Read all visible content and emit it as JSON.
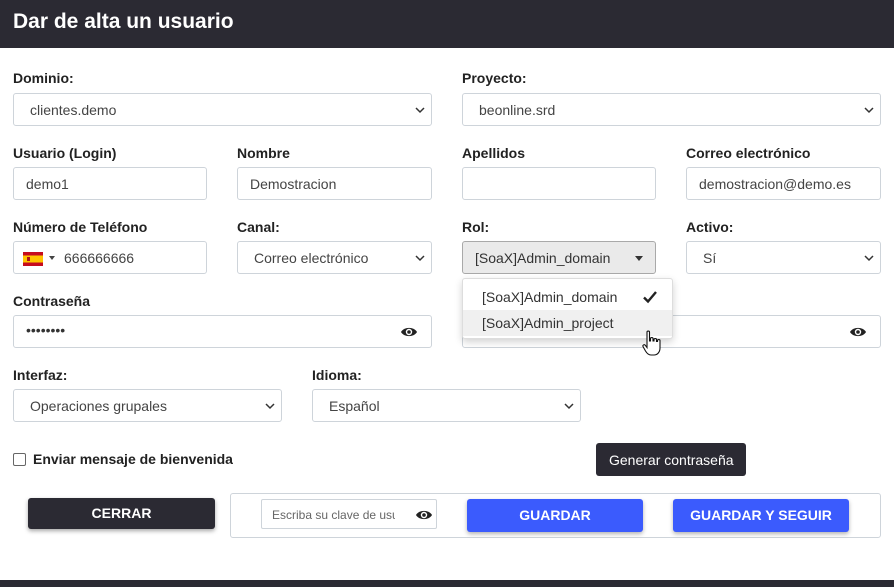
{
  "header": {
    "title": "Dar de alta un usuario"
  },
  "fields": {
    "dominio": {
      "label": "Dominio:",
      "value": "clientes.demo"
    },
    "proyecto": {
      "label": "Proyecto:",
      "value": "beonline.srd"
    },
    "usuario": {
      "label": "Usuario (Login)",
      "value": "demo1"
    },
    "nombre": {
      "label": "Nombre",
      "value": "Demostracion"
    },
    "apellidos": {
      "label": "Apellidos",
      "value": ""
    },
    "correo": {
      "label": "Correo electrónico",
      "value": "demostracion@demo.es"
    },
    "telefono": {
      "label": "Número de Teléfono",
      "value": "666666666",
      "flag": "spain-flag-icon"
    },
    "canal": {
      "label": "Canal:",
      "value": "Correo electrónico"
    },
    "rol": {
      "label": "Rol:",
      "value": "[SoaX]Admin_domain"
    },
    "activo": {
      "label": "Activo:",
      "value": "Sí"
    },
    "contrasena": {
      "label": "Contraseña",
      "value": "••••••••"
    },
    "interfaz": {
      "label": "Interfaz:",
      "value": "Operaciones grupales"
    },
    "idioma": {
      "label": "Idioma:",
      "value": "Español"
    }
  },
  "rol_dropdown": {
    "options": [
      {
        "label": "[SoaX]Admin_domain",
        "selected": true
      },
      {
        "label": "[SoaX]Admin_project",
        "hovered": true
      }
    ]
  },
  "welcome": {
    "label": "Enviar mensaje de bienvenida",
    "checked": false
  },
  "tooltip": {
    "text": "Generar contraseña"
  },
  "footer": {
    "close_label": "CERRAR",
    "key_placeholder": "Escriba su clave de usuario",
    "save_label": "GUARDAR",
    "save_continue_label": "GUARDAR Y SEGUIR"
  },
  "colors": {
    "dark": "#2b2a33",
    "primary": "#3b5bfd"
  }
}
